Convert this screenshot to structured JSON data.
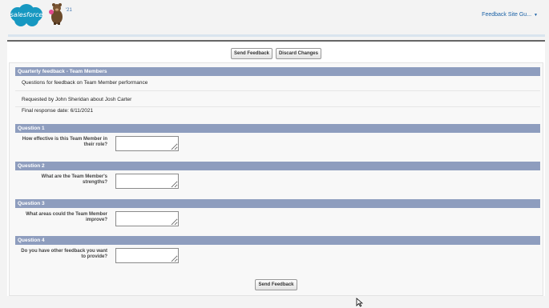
{
  "header": {
    "logo_text": "salesforce",
    "release_badge": "'21",
    "user_menu_label": "Feedback Site Gu...",
    "user_menu_caret": "▼"
  },
  "buttons": {
    "send_feedback": "Send Feedback",
    "discard_changes": "Discard Changes"
  },
  "summary": {
    "title": "Quarterly feedback - Team Members",
    "description": "Questions for feedback on Team Member performance",
    "requested_by": "Requested by John Sheridan about Josh Carter",
    "final_response_date": "Final response date: 6/11/2021"
  },
  "questions": [
    {
      "heading": "Question 1",
      "label": "How effective is this Team Member in their role?",
      "value": ""
    },
    {
      "heading": "Question 2",
      "label": "What are the Team Member's strengths?",
      "value": ""
    },
    {
      "heading": "Question 3",
      "label": "What areas could the Team Member improve?",
      "value": ""
    },
    {
      "heading": "Question 4",
      "label": "Do you have other feedback you want to provide?",
      "value": ""
    }
  ],
  "colors": {
    "section_header": "#8e9dbe",
    "logo_blue": "#1798c1",
    "link_blue": "#1b62a6"
  }
}
